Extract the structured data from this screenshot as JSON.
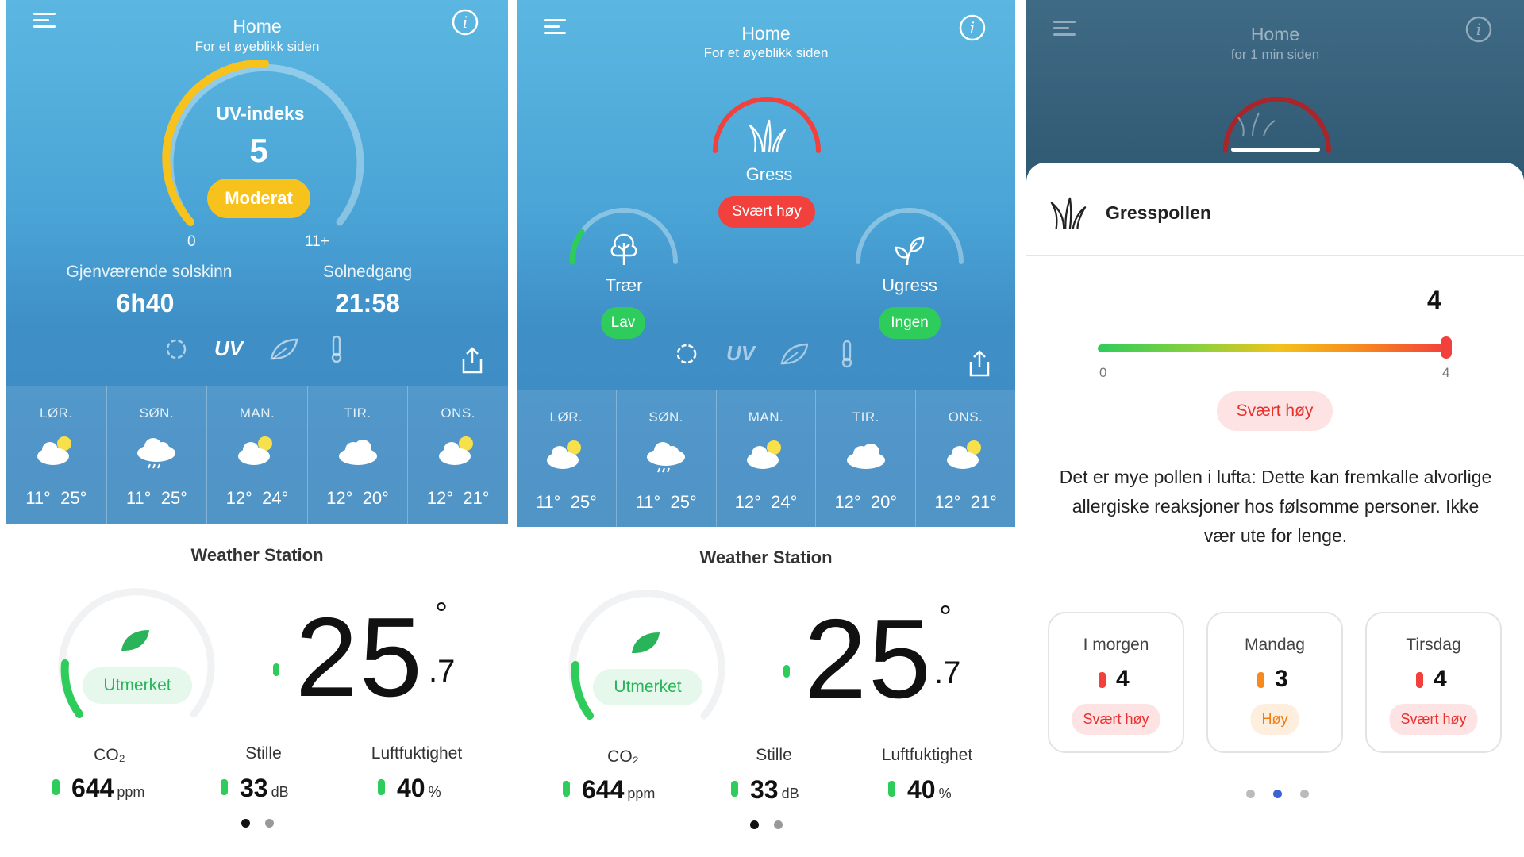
{
  "panels": {
    "uv": {
      "header": {
        "title": "Home",
        "subtitle": "For et øyeblikk siden"
      },
      "gauge": {
        "label": "UV-indeks",
        "value": "5",
        "badge": "Moderat",
        "min_label": "0",
        "max_label": "11+",
        "level_fraction": 0.45,
        "color": "#f7c21b"
      },
      "stats": [
        {
          "label": "Gjenværende solskinn",
          "value": "6h40"
        },
        {
          "label": "Solnedgang",
          "value": "21:58"
        }
      ],
      "tabs": [
        {
          "name": "pollen-tab",
          "icon": "pollen-flower-icon",
          "label": ""
        },
        {
          "name": "uv-tab",
          "icon": "uv-icon",
          "label": "UV",
          "active": true
        },
        {
          "name": "air-tab",
          "icon": "leaf-icon",
          "label": ""
        },
        {
          "name": "temperature-tab",
          "icon": "thermometer-icon",
          "label": ""
        }
      ],
      "forecast": [
        {
          "day": "LØR.",
          "icon": "partly-sunny-icon",
          "low": "11°",
          "high": "25°"
        },
        {
          "day": "SØN.",
          "icon": "rain-cloud-icon",
          "low": "11°",
          "high": "25°"
        },
        {
          "day": "MAN.",
          "icon": "partly-sunny-icon",
          "low": "12°",
          "high": "24°"
        },
        {
          "day": "TIR.",
          "icon": "cloud-icon",
          "low": "12°",
          "high": "20°"
        },
        {
          "day": "ONS.",
          "icon": "partly-sunny-icon",
          "low": "12°",
          "high": "21°"
        }
      ],
      "station": {
        "title": "Weather Station",
        "air_quality": "Utmerket",
        "temp_int": "25",
        "temp_dec": ".7",
        "degree": "°",
        "metrics": [
          {
            "label": "CO₂",
            "value": "644",
            "unit": "ppm"
          },
          {
            "label": "Stille",
            "value": "33",
            "unit": "dB"
          },
          {
            "label": "Luftfuktighet",
            "value": "40",
            "unit": "%"
          }
        ]
      }
    },
    "pollen": {
      "header": {
        "title": "Home",
        "subtitle": "For et øyeblikk siden"
      },
      "main": {
        "label": "Gress",
        "badge": "Svært høy",
        "color": "#f2403c"
      },
      "left": {
        "label": "Trær",
        "badge": "Lav",
        "color": "#2ecc5a",
        "level_fraction": 0.12
      },
      "right": {
        "label": "Ugress",
        "badge": "Ingen",
        "color": "#2ecc5a",
        "level_fraction": 0.0
      },
      "tabs": [
        {
          "name": "pollen-tab",
          "icon": "pollen-flower-icon",
          "label": "",
          "active": true
        },
        {
          "name": "uv-tab",
          "icon": "uv-icon",
          "label": "UV"
        },
        {
          "name": "air-tab",
          "icon": "leaf-icon",
          "label": ""
        },
        {
          "name": "temperature-tab",
          "icon": "thermometer-icon",
          "label": ""
        }
      ],
      "forecast": [
        {
          "day": "LØR.",
          "icon": "partly-sunny-icon",
          "low": "11°",
          "high": "25°"
        },
        {
          "day": "SØN.",
          "icon": "rain-cloud-icon",
          "low": "11°",
          "high": "25°"
        },
        {
          "day": "MAN.",
          "icon": "partly-sunny-icon",
          "low": "12°",
          "high": "24°"
        },
        {
          "day": "TIR.",
          "icon": "cloud-icon",
          "low": "12°",
          "high": "20°"
        },
        {
          "day": "ONS.",
          "icon": "partly-sunny-icon",
          "low": "12°",
          "high": "21°"
        }
      ],
      "station": {
        "title": "Weather Station",
        "air_quality": "Utmerket",
        "temp_int": "25",
        "temp_dec": ".7",
        "degree": "°",
        "metrics": [
          {
            "label": "CO₂",
            "value": "644",
            "unit": "ppm"
          },
          {
            "label": "Stille",
            "value": "33",
            "unit": "dB"
          },
          {
            "label": "Luftfuktighet",
            "value": "40",
            "unit": "%"
          }
        ]
      }
    },
    "detail": {
      "header": {
        "title": "Home",
        "subtitle": "for 1 min siden"
      },
      "sheet_title": "Gresspollen",
      "scale": {
        "value": "4",
        "min_label": "0",
        "max_label": "4",
        "level_fraction": 1.0
      },
      "badge": "Svært høy",
      "description": "Det er mye pollen i lufta: Dette kan fremkalle alvorlige allergiske reaksjoner hos følsomme personer. Ikke vær ute for lenge.",
      "days": [
        {
          "day": "I morgen",
          "value": "4",
          "badge": "Svært høy",
          "color": "#f2403c",
          "bg": "#fde3e3",
          "text": "#e8302c"
        },
        {
          "day": "Mandag",
          "value": "3",
          "badge": "Høy",
          "color": "#f78a1e",
          "bg": "#fdeede",
          "text": "#f07d10"
        },
        {
          "day": "Tirsdag",
          "value": "4",
          "badge": "Svært høy",
          "color": "#f2403c",
          "bg": "#fde3e3",
          "text": "#e8302c"
        }
      ]
    }
  },
  "colors": {
    "green": "#2ecc5a",
    "red": "#f2403c",
    "yellow": "#f7c21b",
    "page_indicator_active": "#3a63d6"
  }
}
